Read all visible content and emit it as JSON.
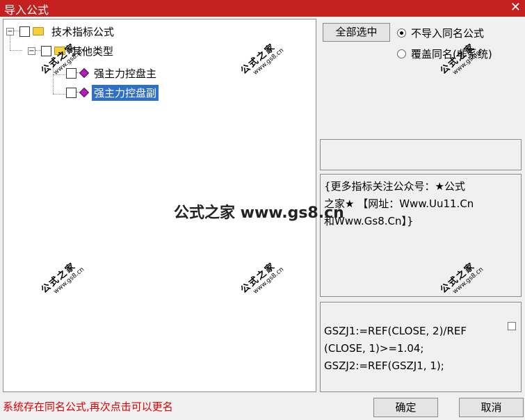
{
  "window": {
    "title": "导入公式",
    "close_glyph": "✕"
  },
  "tree": {
    "root": {
      "label": "技术指标公式",
      "expander": "−"
    },
    "group": {
      "label": "其他类型",
      "expander": "−"
    },
    "items": [
      {
        "label": "强主力控盘主"
      },
      {
        "label": "强主力控盘副"
      }
    ]
  },
  "actions": {
    "select_all": "全部选中",
    "radio_skip": "不导入同名公式",
    "radio_overwrite": "覆盖同名(非系统)",
    "ok": "确定",
    "cancel": "取消"
  },
  "description": {
    "line1": "{更多指标关注公众号：★公式",
    "line2": "之家★ 【网址：Www.Uu11.Cn",
    "line3": "和Www.Gs8.Cn】}"
  },
  "code": {
    "line1": "GSZJ1:=REF(CLOSE, 2)/REF",
    "line2": "(CLOSE, 1)>=1.04;",
    "line3": "GSZJ2:=REF(GSZJ1, 1);"
  },
  "status": "系统存在同名公式,再次点击可以更名",
  "watermark": {
    "cn": "公式之家",
    "en": "www.gs8.cn",
    "big": "公式之家 www.gs8.cn"
  },
  "colors": {
    "title_bar": "#c42020",
    "selection": "#2f6fc6",
    "status_text": "#e00000"
  }
}
